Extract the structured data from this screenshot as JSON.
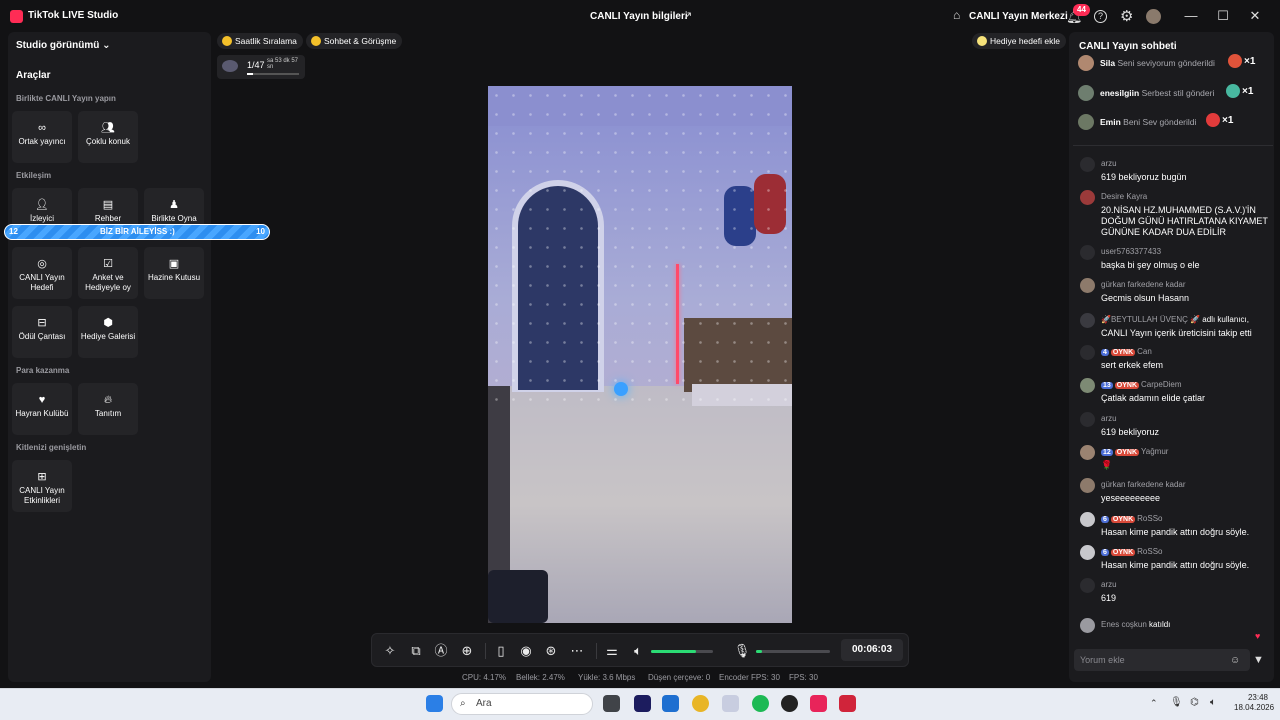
{
  "app": {
    "title": "TikTok LIVE Studio",
    "live_info": "CANLI Yayın bilgileri",
    "live_center": "CANLI Yayın Merkezi",
    "notif_count": "44"
  },
  "left": {
    "studio_view": "Studio görünümü",
    "tools_title": "Araçlar",
    "sec_together": "Birlikte CANLI Yayın yapın",
    "sec_interaction": "Etkileşim",
    "sec_earn": "Para kazanma",
    "sec_expand": "Kitlenizi genişletin",
    "tiles": {
      "cohost": "Ortak yayıncı",
      "multiguest": "Çoklu konuk",
      "viewer": "İzleyici",
      "guide": "Rehber",
      "playtogether": "Birlikte Oyna",
      "livegoal": "CANLI Yayın Hedefi",
      "poll": "Anket ve Hediyeyle oy",
      "treasure": "Hazine Kutusu",
      "rewardbag": "Ödül Çantası",
      "giftgallery": "Hediye Galerisi",
      "fanclub": "Hayran Kulübü",
      "promo": "Tanıtım",
      "events": "CANLI Yayın Etkinlikleri"
    },
    "goal": {
      "left": "12",
      "text": "BİZ BİR AİLEYİSS :)",
      "right": "10"
    }
  },
  "chips": {
    "hourly": "Saatlik Sıralama",
    "chat": "Sohbet & Görüşme",
    "gift_goal": "Hediye hedefi ekle"
  },
  "counter": {
    "value": "1/47",
    "timer": "sa 53 dk 57 sn"
  },
  "controls": {
    "timer": "00:06:03",
    "volume": 0.72,
    "mic": 0.08
  },
  "stats": {
    "cpu": "CPU: 4.17%",
    "memory": "Bellek: 2.47%",
    "upload": "Yükle: 3.6 Mbps",
    "dropped": "Düşen çerçeve: 0",
    "encoder": "Encoder FPS: 30",
    "fps": "FPS: 30"
  },
  "chat": {
    "title": "CANLI Yayın sohbeti",
    "gifts": [
      {
        "user": "Sila",
        "msg": "Seni seviyorum gönderildi",
        "count": "×1"
      },
      {
        "user": "enesilgiin",
        "msg": "Serbest stil gönderi",
        "count": "×1"
      },
      {
        "user": "Emin",
        "msg": "Beni Sev gönderildi",
        "count": "×1"
      }
    ],
    "messages": [
      {
        "user": "arzu",
        "text": "619 bekliyoruz bugün"
      },
      {
        "user": "Desire Kayra",
        "text": "20.NİSAN HZ.MUHAMMED (S.A.V.)'İN DOĞUM GÜNÜ HATIRLATANA KIYAMET GÜNÜNE KADAR DUA EDİLİR"
      },
      {
        "user": "user5763377433",
        "text": "başka bi şey olmuş o ele"
      },
      {
        "user": "gürkan farkedene kadar",
        "text": "Gecmis olsun Hasann"
      },
      {
        "user": "🚀BEYTULLAH ÜVENÇ 🚀",
        "suffix": "adlı kullanıcı,",
        "text": "CANLI Yayın içerik üreticisini takip etti"
      },
      {
        "level": "4",
        "tag": "OYNK",
        "user": "Can",
        "text": "sert erkek efem"
      },
      {
        "level": "13",
        "tag": "OYNK",
        "user": "CarpeDiem",
        "text": "Çatlak adamın elide çatlar"
      },
      {
        "user": "arzu",
        "text": "619 bekliyoruz"
      },
      {
        "level": "12",
        "tag": "OYNK",
        "user": "Yağmur",
        "text": "🌹"
      },
      {
        "user": "gürkan farkedene kadar",
        "text": "yeseeeeeeeee"
      },
      {
        "level": "6",
        "tag": "OYNK",
        "user": "RoSSo",
        "text": "Hasan kime pandik attın doğru söyle."
      },
      {
        "level": "6",
        "tag": "OYNK",
        "user": "RoSSo",
        "text": "Hasan kime pandik attın doğru söyle."
      },
      {
        "user": "arzu",
        "text": "619"
      }
    ],
    "joined_user": "Enes coşkun",
    "joined_text": "katıldı",
    "comment_placeholder": "Yorum ekle"
  },
  "taskbar": {
    "search": "Ara",
    "time": "23:48",
    "date": "18.04.2026"
  }
}
